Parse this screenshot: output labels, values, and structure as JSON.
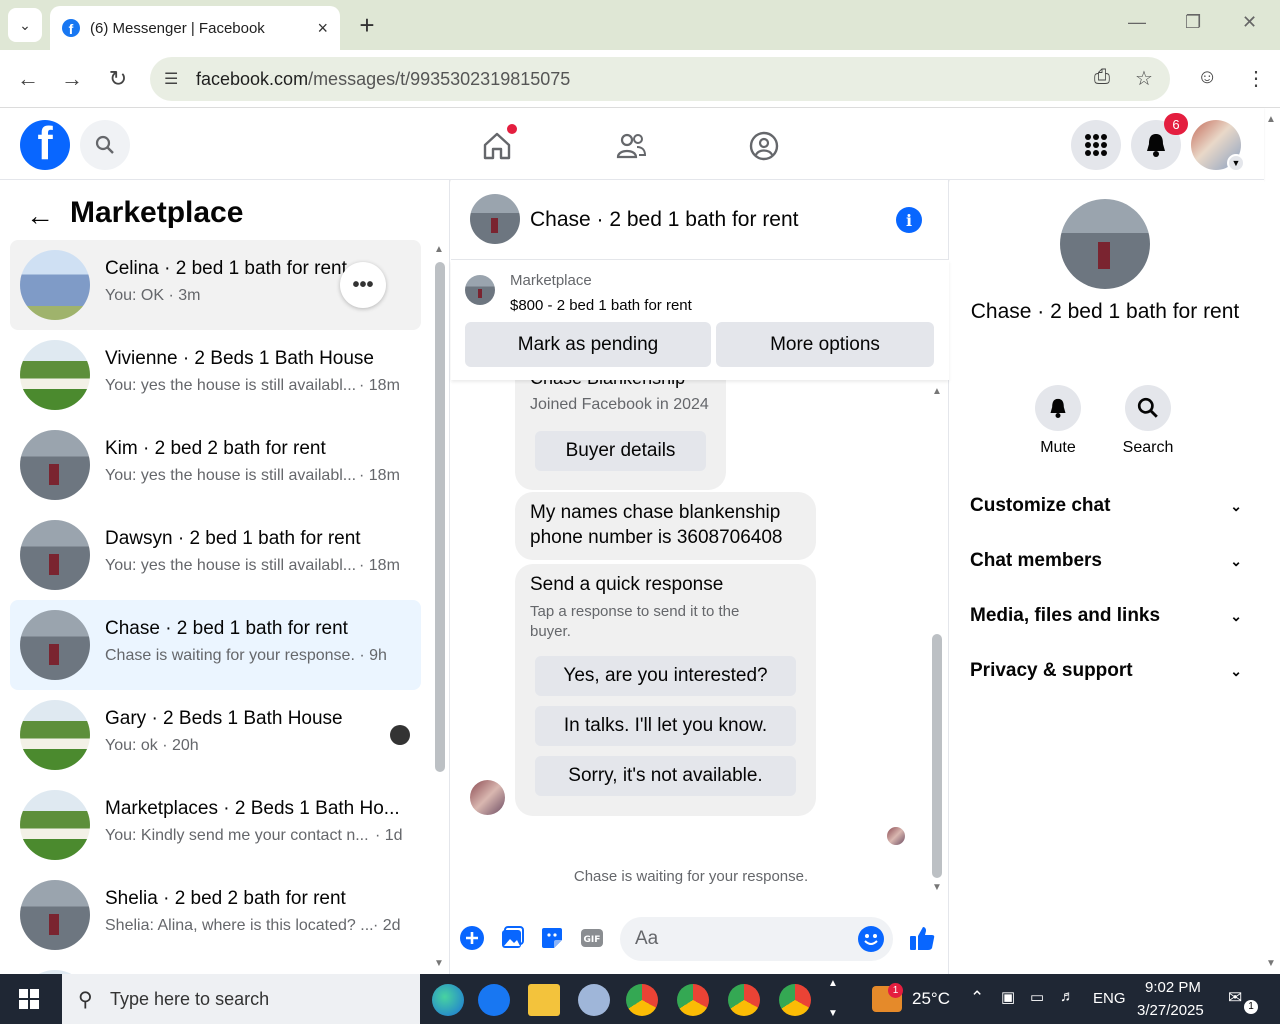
{
  "browser": {
    "tab_title": "(6) Messenger | Facebook",
    "url_host": "facebook.com",
    "url_path": "/messages/t/9935302319815075"
  },
  "fb": {
    "notification_count": "6",
    "colors": {
      "brand": "#0866ff",
      "badge": "#e41e3f"
    }
  },
  "sidebar": {
    "title": "Marketplace",
    "conversations": [
      {
        "name": "Celina · 2 bed 1 bath for rent",
        "preview": "You: OK · 3m",
        "time": "",
        "thumb": "blue-house"
      },
      {
        "name": "Vivienne · 2 Beds 1 Bath House",
        "preview": "You: yes the house is still availabl...",
        "time": "· 18m",
        "thumb": "green-house"
      },
      {
        "name": "Kim · 2 bed 2 bath for rent",
        "preview": "You: yes the house is still availabl...",
        "time": "· 18m",
        "thumb": "grey-house"
      },
      {
        "name": "Dawsyn · 2 bed 1 bath for rent",
        "preview": "You: yes the house is still availabl...",
        "time": "· 18m",
        "thumb": "grey-house"
      },
      {
        "name": "Chase · 2 bed 1 bath for rent",
        "preview": "Chase is waiting for your response. · 9h",
        "time": "",
        "thumb": "grey-house"
      },
      {
        "name": "Gary · 2 Beds 1 Bath House",
        "preview": "You: ok · 20h",
        "time": "",
        "thumb": "green-house"
      },
      {
        "name": "Marketplaces · 2 Beds 1 Bath Ho...",
        "preview": "You: Kindly send me your contact n...",
        "time": "· 1d",
        "thumb": "green-house"
      },
      {
        "name": "Shelia · 2 bed 2 bath for rent",
        "preview": "Shelia: Alina, where is this located? ...",
        "time": "· 2d",
        "thumb": "grey-house"
      }
    ]
  },
  "chat": {
    "title": "Chase · 2 bed 1 bath for rent",
    "listing_label": "Marketplace",
    "listing_price": "$800 - 2 bed 1 bath for rent",
    "mark_pending": "Mark as pending",
    "more_options": "More options",
    "buyer_name": "Chase Blankenship",
    "joined": "Joined Facebook in 2024",
    "buyer_details": "Buyer details",
    "message_line1": "My names chase blankenship",
    "message_line2": "phone number is 3608706408",
    "quick_title": "Send a quick response",
    "quick_sub_line1": "Tap a response to send it to the",
    "quick_sub_line2": "buyer.",
    "quick_responses": [
      "Yes, are you interested?",
      "In talks. I'll let you know.",
      "Sorry, it's not available."
    ],
    "waiting": "Chase is waiting for your response.",
    "composer_placeholder": "Aa"
  },
  "details": {
    "name": "Chase · 2 bed 1 bath for rent",
    "mute": "Mute",
    "search": "Search",
    "sections": [
      "Customize chat",
      "Chat members",
      "Media, files and links",
      "Privacy & support"
    ]
  },
  "taskbar": {
    "search_placeholder": "Type here to search",
    "weather_badge": "1",
    "temperature": "25°C",
    "language": "ENG",
    "time": "9:02 PM",
    "date": "3/27/2025",
    "notif_count": "1"
  }
}
